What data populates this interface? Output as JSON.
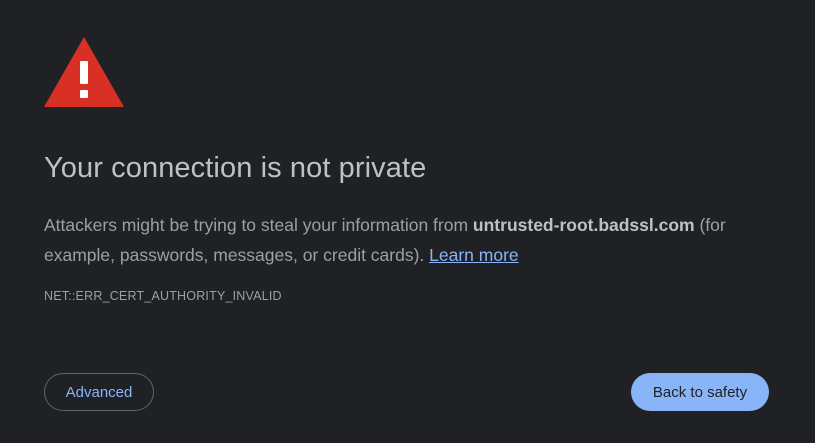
{
  "icons": {
    "warning": "warning-triangle-icon",
    "warning_color": "#d93025"
  },
  "heading": "Your connection is not private",
  "description": {
    "before_host": "Attackers might be trying to steal your information from ",
    "host": "untrusted-root.badssl.com",
    "after_host": " (for example, passwords, messages, or credit cards). ",
    "learn_more": "Learn more"
  },
  "error_code": "NET::ERR_CERT_AUTHORITY_INVALID",
  "buttons": {
    "advanced": "Advanced",
    "back_to_safety": "Back to safety"
  },
  "colors": {
    "background": "#202124",
    "link": "#8ab4f8",
    "primary_button": "#8ab4f8"
  }
}
